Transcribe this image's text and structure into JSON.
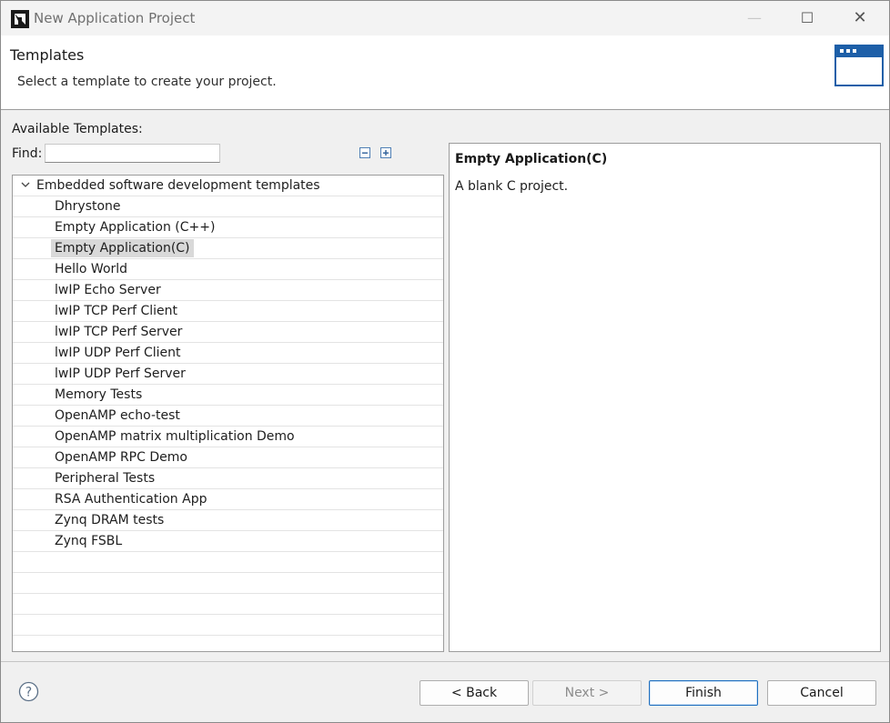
{
  "window": {
    "title": "New Application Project",
    "controls": {
      "minimize": "—",
      "maximize": "☐",
      "close": "✕"
    }
  },
  "header": {
    "title": "Templates",
    "description": "Select a template to create your project."
  },
  "templates": {
    "available_label": "Available Templates:",
    "find_label": "Find:",
    "find_value": "",
    "root": {
      "label": "Embedded software development templates",
      "expanded": true,
      "items": [
        {
          "label": "Dhrystone",
          "selected": false
        },
        {
          "label": "Empty Application (C++)",
          "selected": false
        },
        {
          "label": "Empty Application(C)",
          "selected": true
        },
        {
          "label": "Hello World",
          "selected": false
        },
        {
          "label": "lwIP Echo Server",
          "selected": false
        },
        {
          "label": "lwIP TCP Perf Client",
          "selected": false
        },
        {
          "label": "lwIP TCP Perf Server",
          "selected": false
        },
        {
          "label": "lwIP UDP Perf Client",
          "selected": false
        },
        {
          "label": "lwIP UDP Perf Server",
          "selected": false
        },
        {
          "label": "Memory Tests",
          "selected": false
        },
        {
          "label": "OpenAMP echo-test",
          "selected": false
        },
        {
          "label": "OpenAMP matrix multiplication Demo",
          "selected": false
        },
        {
          "label": "OpenAMP RPC Demo",
          "selected": false
        },
        {
          "label": "Peripheral Tests",
          "selected": false
        },
        {
          "label": "RSA Authentication App",
          "selected": false
        },
        {
          "label": "Zynq DRAM tests",
          "selected": false
        },
        {
          "label": "Zynq FSBL",
          "selected": false
        }
      ]
    }
  },
  "description": {
    "title": "Empty Application(C)",
    "text": "A blank C project."
  },
  "footer": {
    "help": "?",
    "back": "< Back",
    "next": "Next >",
    "finish": "Finish",
    "cancel": "Cancel"
  },
  "colors": {
    "accent": "#1f6fbf",
    "selection": "#d9d9d9",
    "wizard_icon": "#1d5fa8"
  }
}
